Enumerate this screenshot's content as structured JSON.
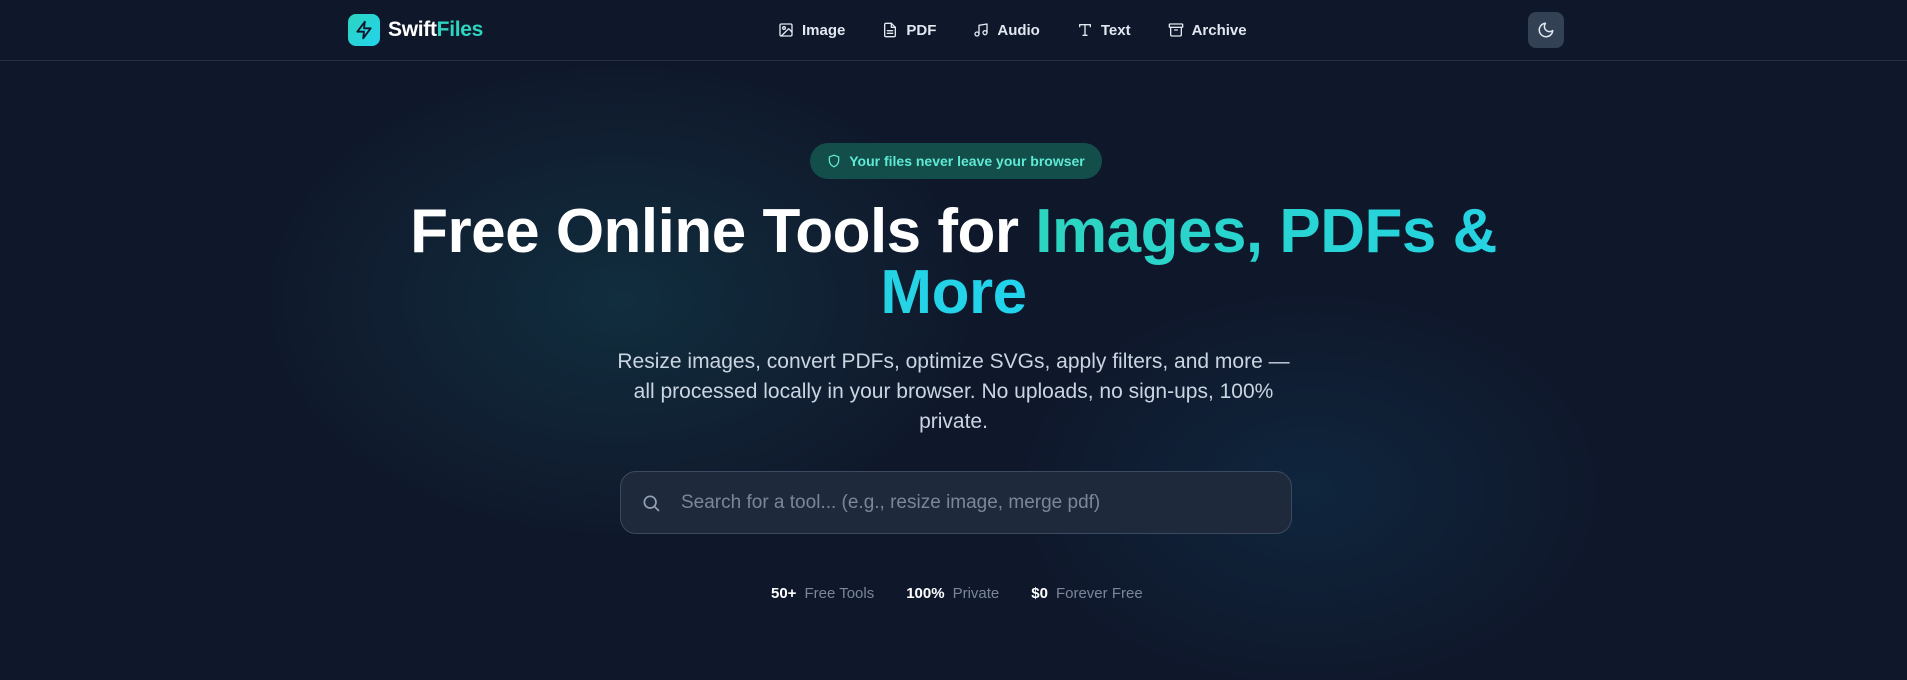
{
  "colors": {
    "background": "#0f172a",
    "accent": "#2dd4bf",
    "accent_cyan": "#22d3ee",
    "badge_bg": "#134e4a",
    "search_bg": "#1e293b"
  },
  "header": {
    "logo": {
      "part1": "Swift",
      "part2": "Files",
      "icon": "lightning-bolt-icon"
    },
    "nav": [
      {
        "label": "Image",
        "icon": "image-icon"
      },
      {
        "label": "PDF",
        "icon": "file-text-icon"
      },
      {
        "label": "Audio",
        "icon": "music-note-icon"
      },
      {
        "label": "Text",
        "icon": "text-type-icon"
      },
      {
        "label": "Archive",
        "icon": "archive-box-icon"
      }
    ],
    "theme_toggle_icon": "moon-icon"
  },
  "hero": {
    "badge": {
      "text": "Your files never leave your browser",
      "icon": "shield-icon"
    },
    "headline": {
      "plain": "Free Online Tools for ",
      "accent": "Images, PDFs & More"
    },
    "subtitle": "Resize images, convert PDFs, optimize SVGs, apply filters, and more — all processed locally in your browser. No uploads, no sign-ups, 100% private.",
    "search": {
      "placeholder": "Search for a tool... (e.g., resize image, merge pdf)",
      "value": "",
      "icon": "search-icon"
    },
    "stats": [
      {
        "value": "50+",
        "label": "Free Tools"
      },
      {
        "value": "100%",
        "label": "Private"
      },
      {
        "value": "$0",
        "label": "Forever Free"
      }
    ]
  }
}
